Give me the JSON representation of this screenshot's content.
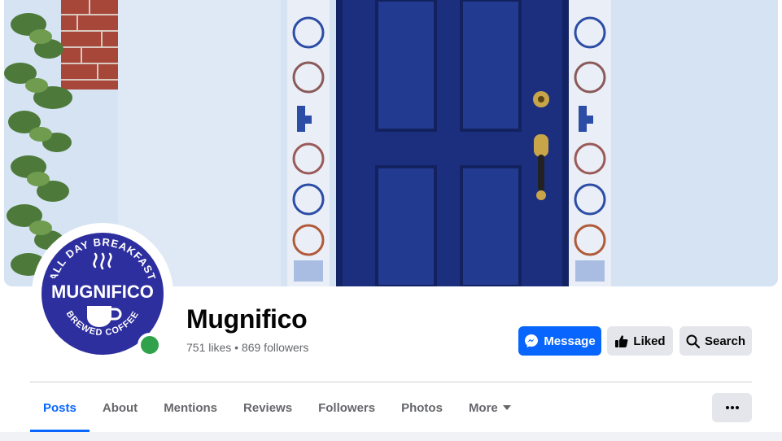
{
  "colors": {
    "accent": "#0866ff",
    "online": "#31a24c",
    "logo_blue": "#2e2f9e",
    "door_blue": "#1c2f7e"
  },
  "cover": {
    "description_icon": "cover-photo"
  },
  "profile": {
    "logo_text_top": "ALL DAY BREAKFAST",
    "logo_text_main": "MUGNIFICO",
    "logo_text_bottom": "BREWED COFFEE",
    "name": "Mugnifico",
    "stats": "751 likes • 869 followers",
    "online": true
  },
  "actions": {
    "message_label": "Message",
    "message_icon": "messenger-icon",
    "liked_label": "Liked",
    "liked_icon": "thumbs-up-icon",
    "search_label": "Search",
    "search_icon": "search-icon"
  },
  "tabs": [
    {
      "label": "Posts",
      "active": true
    },
    {
      "label": "About",
      "active": false
    },
    {
      "label": "Mentions",
      "active": false
    },
    {
      "label": "Reviews",
      "active": false
    },
    {
      "label": "Followers",
      "active": false
    },
    {
      "label": "Photos",
      "active": false
    },
    {
      "label": "More",
      "active": false
    }
  ],
  "more_menu_icon": "ellipsis-icon"
}
